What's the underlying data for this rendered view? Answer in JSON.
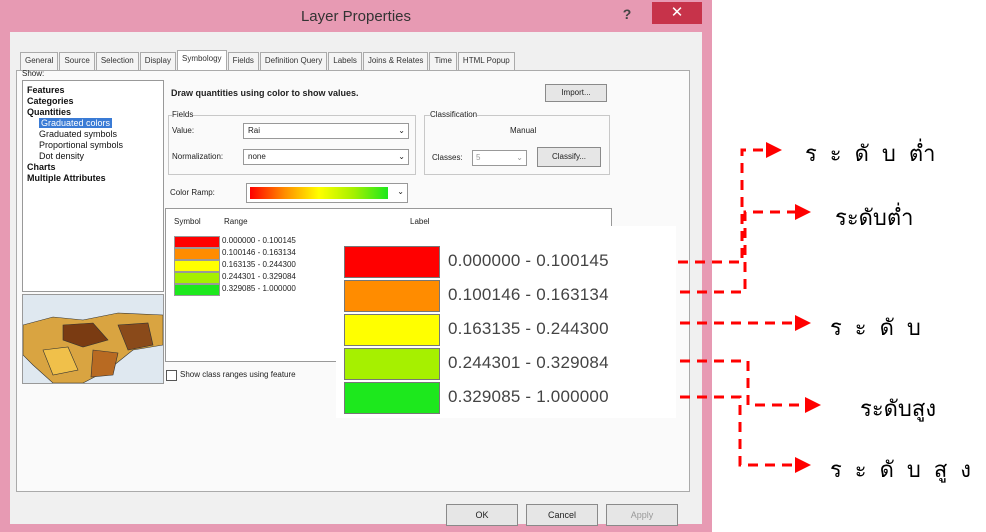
{
  "window": {
    "title": "Layer Properties",
    "help": "?",
    "close": "✕"
  },
  "tabs": [
    "General",
    "Source",
    "Selection",
    "Display",
    "Symbology",
    "Fields",
    "Definition Query",
    "Labels",
    "Joins & Relates",
    "Time",
    "HTML Popup"
  ],
  "show": {
    "label": "Show:",
    "items": [
      "Features",
      "Categories",
      "Quantities",
      "Graduated colors",
      "Graduated symbols",
      "Proportional symbols",
      "Dot density",
      "Charts",
      "Multiple Attributes"
    ]
  },
  "symbology": {
    "heading": "Draw quantities using color to show values.",
    "import_label": "Import...",
    "fields_label": "Fields",
    "value_label": "Value:",
    "value": "Rai",
    "normalization_label": "Normalization:",
    "normalization": "none",
    "classification_label": "Classification",
    "classification_method": "Manual",
    "classes_label": "Classes:",
    "classes_value": "5",
    "classify_label": "Classify...",
    "color_ramp_label": "Color Ramp:",
    "col_symbol": "Symbol",
    "col_range": "Range",
    "col_label": "Label",
    "show_class_ranges": "Show class ranges using feature"
  },
  "classes": [
    {
      "color": "#ff0000",
      "range": "0.000000 - 0.100145"
    },
    {
      "color": "#ff8c00",
      "range": "0.100146 - 0.163134"
    },
    {
      "color": "#ffff00",
      "range": "0.163135 - 0.244300"
    },
    {
      "color": "#a6f000",
      "range": "0.244301 - 0.329084"
    },
    {
      "color": "#1de81d",
      "range": "0.329085 - 1.000000"
    }
  ],
  "zoom": [
    {
      "color": "#ff0000",
      "range": "0.000000 - 0.100145"
    },
    {
      "color": "#ff8c00",
      "range": "0.100146 - 0.163134"
    },
    {
      "color": "#ffff00",
      "range": "0.163135 - 0.244300"
    },
    {
      "color": "#a6f000",
      "range": "0.244301 - 0.329084"
    },
    {
      "color": "#1de81d",
      "range": "0.329085 - 1.000000"
    }
  ],
  "annotations": [
    "ร ะ ดั บ ต่ำ",
    "ระดับต่ำ",
    "ร ะ ดั บ",
    "ระดับสูง",
    "ร ะ ดั บ สู ง"
  ],
  "buttons": {
    "ok": "OK",
    "cancel": "Cancel",
    "apply": "Apply"
  },
  "colors": {
    "frame": "#e79ab3",
    "close": "#c7334a",
    "arrow": "#ff0000",
    "selected": "#3a7bd5"
  }
}
